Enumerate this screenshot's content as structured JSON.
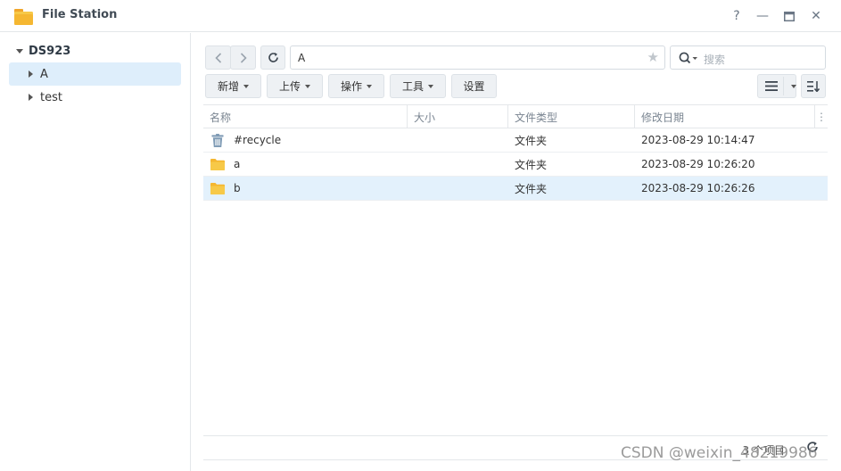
{
  "window": {
    "title": "File Station",
    "help": "?",
    "minimize": "—",
    "close": "✕"
  },
  "sidebar": {
    "root": "DS923",
    "items": [
      {
        "label": "A",
        "selected": true
      },
      {
        "label": "test",
        "selected": false
      }
    ]
  },
  "toolbar": {
    "path": "A",
    "search_placeholder": "搜索",
    "buttons": {
      "create": "新增",
      "upload": "上传",
      "action": "操作",
      "tools": "工具",
      "settings": "设置"
    }
  },
  "table": {
    "columns": [
      "名称",
      "大小",
      "文件类型",
      "修改日期"
    ],
    "rows": [
      {
        "name": "#recycle",
        "size": "",
        "type": "文件夹",
        "modified": "2023-08-29 10:14:47",
        "icon": "recycle-bin-icon"
      },
      {
        "name": "a",
        "size": "",
        "type": "文件夹",
        "modified": "2023-08-29 10:26:20",
        "icon": "folder-icon"
      },
      {
        "name": "b",
        "size": "",
        "type": "文件夹",
        "modified": "2023-08-29 10:26:26",
        "icon": "folder-icon",
        "selected": true
      }
    ]
  },
  "footer": {
    "count": "3 个项目"
  },
  "watermark": "CSDN @weixin_48219986",
  "colors": {
    "folder": "#f7c948",
    "selected_bg": "#e3f1fc",
    "sidebar_selected": "#deeefb",
    "recycle": "#7f9bb5"
  }
}
